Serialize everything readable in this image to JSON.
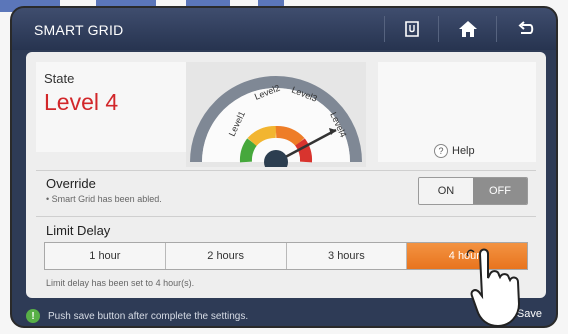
{
  "app": {
    "title": "SMART GRID",
    "toolbar": {
      "icons": [
        "manual-icon",
        "home-icon",
        "back-icon"
      ]
    }
  },
  "state": {
    "label": "State",
    "value": "Level 4",
    "gauge": {
      "levels": [
        "Level1",
        "Level2",
        "Level3",
        "Level4"
      ],
      "current_level": 4,
      "colors": {
        "green": "#46a83c",
        "yellow": "#f2b530",
        "orange": "#ee7d27",
        "red": "#d8342e"
      }
    }
  },
  "help": {
    "label": "Help",
    "icon": "?"
  },
  "override": {
    "label": "Override",
    "note": "• Smart Grid has been abled.",
    "on_label": "ON",
    "off_label": "OFF",
    "selected": "OFF"
  },
  "limit_delay": {
    "label": "Limit Delay",
    "options": [
      "1 hour",
      "2 hours",
      "3 hours",
      "4 hours"
    ],
    "selected_index": 3,
    "note": "Limit delay has been set to 4 hour(s)."
  },
  "footer": {
    "info_icon": "!",
    "message": "Push save button after complete the settings.",
    "save_label": "Save"
  },
  "colors": {
    "accent": "#e8741e",
    "state_value": "#d2272a",
    "titlebar": "#2e3b56",
    "info": "#58b047"
  }
}
